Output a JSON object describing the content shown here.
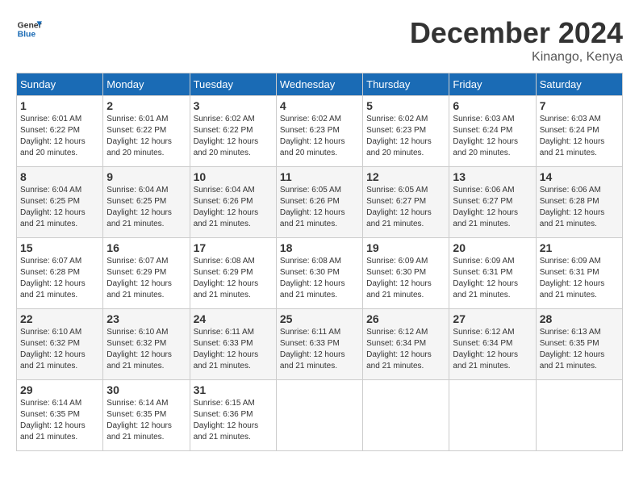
{
  "logo": {
    "text_general": "General",
    "text_blue": "Blue"
  },
  "title": "December 2024",
  "location": "Kinango, Kenya",
  "days_of_week": [
    "Sunday",
    "Monday",
    "Tuesday",
    "Wednesday",
    "Thursday",
    "Friday",
    "Saturday"
  ],
  "weeks": [
    [
      {
        "day": "1",
        "sunrise": "6:01 AM",
        "sunset": "6:22 PM",
        "daylight": "12 hours and 20 minutes."
      },
      {
        "day": "2",
        "sunrise": "6:01 AM",
        "sunset": "6:22 PM",
        "daylight": "12 hours and 20 minutes."
      },
      {
        "day": "3",
        "sunrise": "6:02 AM",
        "sunset": "6:22 PM",
        "daylight": "12 hours and 20 minutes."
      },
      {
        "day": "4",
        "sunrise": "6:02 AM",
        "sunset": "6:23 PM",
        "daylight": "12 hours and 20 minutes."
      },
      {
        "day": "5",
        "sunrise": "6:02 AM",
        "sunset": "6:23 PM",
        "daylight": "12 hours and 20 minutes."
      },
      {
        "day": "6",
        "sunrise": "6:03 AM",
        "sunset": "6:24 PM",
        "daylight": "12 hours and 20 minutes."
      },
      {
        "day": "7",
        "sunrise": "6:03 AM",
        "sunset": "6:24 PM",
        "daylight": "12 hours and 21 minutes."
      }
    ],
    [
      {
        "day": "8",
        "sunrise": "6:04 AM",
        "sunset": "6:25 PM",
        "daylight": "12 hours and 21 minutes."
      },
      {
        "day": "9",
        "sunrise": "6:04 AM",
        "sunset": "6:25 PM",
        "daylight": "12 hours and 21 minutes."
      },
      {
        "day": "10",
        "sunrise": "6:04 AM",
        "sunset": "6:26 PM",
        "daylight": "12 hours and 21 minutes."
      },
      {
        "day": "11",
        "sunrise": "6:05 AM",
        "sunset": "6:26 PM",
        "daylight": "12 hours and 21 minutes."
      },
      {
        "day": "12",
        "sunrise": "6:05 AM",
        "sunset": "6:27 PM",
        "daylight": "12 hours and 21 minutes."
      },
      {
        "day": "13",
        "sunrise": "6:06 AM",
        "sunset": "6:27 PM",
        "daylight": "12 hours and 21 minutes."
      },
      {
        "day": "14",
        "sunrise": "6:06 AM",
        "sunset": "6:28 PM",
        "daylight": "12 hours and 21 minutes."
      }
    ],
    [
      {
        "day": "15",
        "sunrise": "6:07 AM",
        "sunset": "6:28 PM",
        "daylight": "12 hours and 21 minutes."
      },
      {
        "day": "16",
        "sunrise": "6:07 AM",
        "sunset": "6:29 PM",
        "daylight": "12 hours and 21 minutes."
      },
      {
        "day": "17",
        "sunrise": "6:08 AM",
        "sunset": "6:29 PM",
        "daylight": "12 hours and 21 minutes."
      },
      {
        "day": "18",
        "sunrise": "6:08 AM",
        "sunset": "6:30 PM",
        "daylight": "12 hours and 21 minutes."
      },
      {
        "day": "19",
        "sunrise": "6:09 AM",
        "sunset": "6:30 PM",
        "daylight": "12 hours and 21 minutes."
      },
      {
        "day": "20",
        "sunrise": "6:09 AM",
        "sunset": "6:31 PM",
        "daylight": "12 hours and 21 minutes."
      },
      {
        "day": "21",
        "sunrise": "6:09 AM",
        "sunset": "6:31 PM",
        "daylight": "12 hours and 21 minutes."
      }
    ],
    [
      {
        "day": "22",
        "sunrise": "6:10 AM",
        "sunset": "6:32 PM",
        "daylight": "12 hours and 21 minutes."
      },
      {
        "day": "23",
        "sunrise": "6:10 AM",
        "sunset": "6:32 PM",
        "daylight": "12 hours and 21 minutes."
      },
      {
        "day": "24",
        "sunrise": "6:11 AM",
        "sunset": "6:33 PM",
        "daylight": "12 hours and 21 minutes."
      },
      {
        "day": "25",
        "sunrise": "6:11 AM",
        "sunset": "6:33 PM",
        "daylight": "12 hours and 21 minutes."
      },
      {
        "day": "26",
        "sunrise": "6:12 AM",
        "sunset": "6:34 PM",
        "daylight": "12 hours and 21 minutes."
      },
      {
        "day": "27",
        "sunrise": "6:12 AM",
        "sunset": "6:34 PM",
        "daylight": "12 hours and 21 minutes."
      },
      {
        "day": "28",
        "sunrise": "6:13 AM",
        "sunset": "6:35 PM",
        "daylight": "12 hours and 21 minutes."
      }
    ],
    [
      {
        "day": "29",
        "sunrise": "6:14 AM",
        "sunset": "6:35 PM",
        "daylight": "12 hours and 21 minutes."
      },
      {
        "day": "30",
        "sunrise": "6:14 AM",
        "sunset": "6:35 PM",
        "daylight": "12 hours and 21 minutes."
      },
      {
        "day": "31",
        "sunrise": "6:15 AM",
        "sunset": "6:36 PM",
        "daylight": "12 hours and 21 minutes."
      },
      null,
      null,
      null,
      null
    ]
  ]
}
